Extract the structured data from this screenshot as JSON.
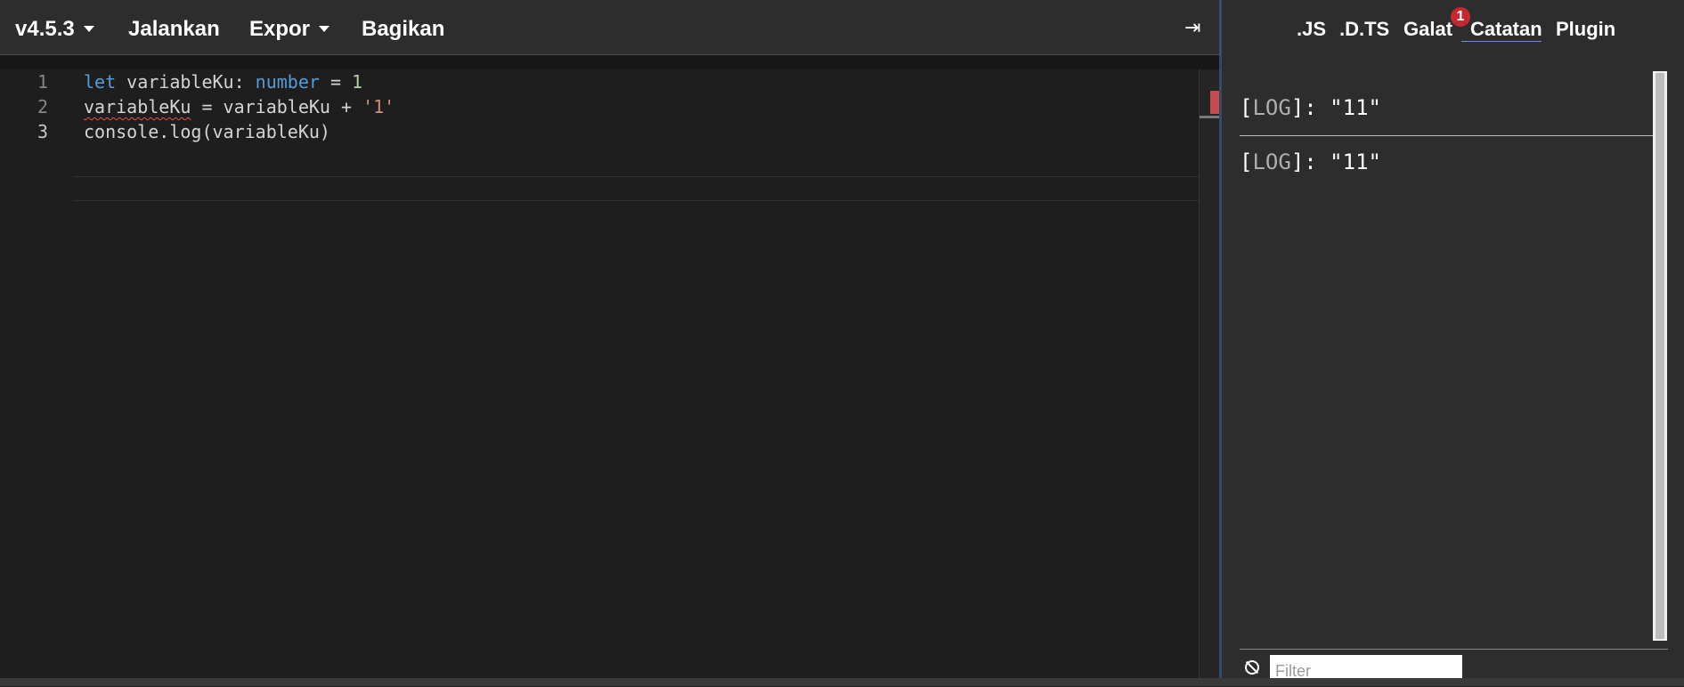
{
  "toolbar": {
    "version": "v4.5.3",
    "run": "Jalankan",
    "export": "Expor",
    "share": "Bagikan",
    "collapse_icon": "⇥"
  },
  "editor": {
    "lines": [
      {
        "number": "1",
        "tokens": [
          {
            "t": "let",
            "c": "kw"
          },
          {
            "t": " variableKu: ",
            "c": ""
          },
          {
            "t": "number",
            "c": "kw"
          },
          {
            "t": " = ",
            "c": ""
          },
          {
            "t": "1",
            "c": "num"
          }
        ]
      },
      {
        "number": "2",
        "tokens": [
          {
            "t": "variableKu",
            "c": "squig"
          },
          {
            "t": " = variableKu + ",
            "c": ""
          },
          {
            "t": "'1'",
            "c": "str"
          }
        ]
      },
      {
        "number": "3",
        "tokens": [
          {
            "t": "console.log(variableKu)",
            "c": ""
          }
        ]
      }
    ]
  },
  "sidebar": {
    "tabs": [
      {
        "id": "js",
        "label": ".JS"
      },
      {
        "id": "dts",
        "label": ".D.TS"
      },
      {
        "id": "errors",
        "label": "Galat"
      },
      {
        "id": "logs",
        "label": "Catatan"
      },
      {
        "id": "plugins",
        "label": "Plugin"
      }
    ],
    "error_badge": "1",
    "logs": [
      {
        "open": "[",
        "level": "LOG",
        "close": "]",
        "message": ": \"11\""
      },
      {
        "open": "[",
        "level": "LOG",
        "close": "]",
        "message": ": \"11\""
      }
    ],
    "filter_placeholder": "Filter"
  },
  "colors": {
    "keyword": "#569cd6",
    "number": "#b5cea8",
    "string": "#ce9178",
    "badge": "#c5282e",
    "error_squiggle": "#e5534b"
  }
}
